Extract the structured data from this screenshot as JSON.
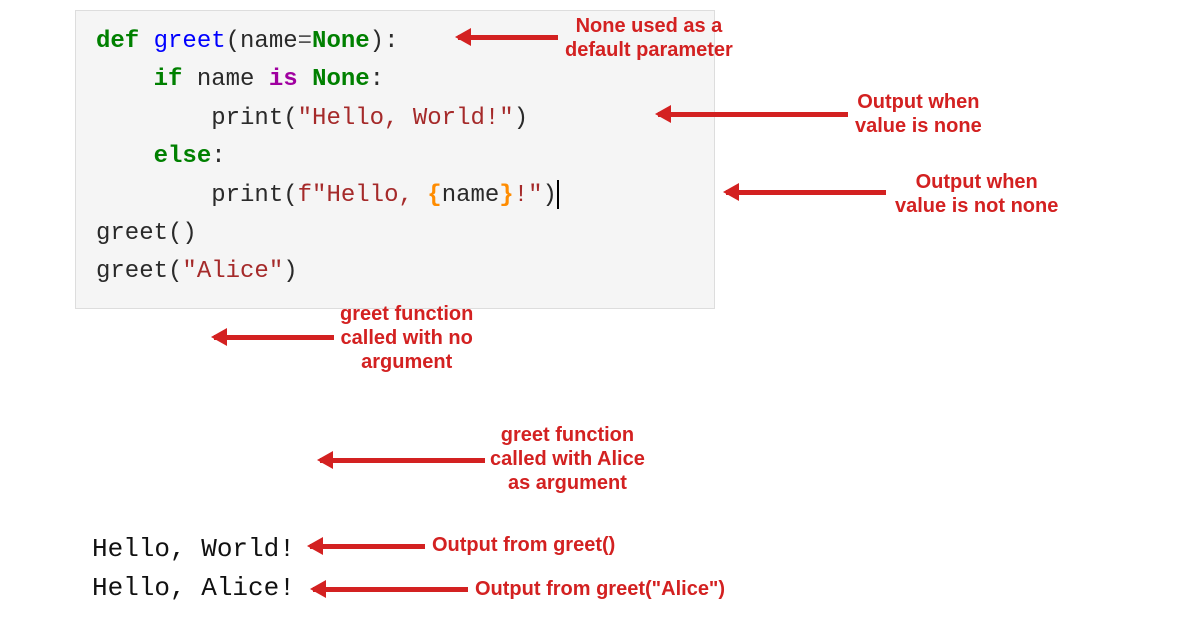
{
  "code": {
    "line1": {
      "def": "def ",
      "fname": "greet",
      "open": "(",
      "param": "name",
      "eq": "=",
      "none": "None",
      "close": ")",
      "colon": ":"
    },
    "line2": {
      "indent": "    ",
      "if": "if ",
      "name": "name",
      "sp": " ",
      "is": "is",
      "sp2": " ",
      "none": "None",
      "colon": ":"
    },
    "line3": {
      "indent": "        ",
      "print": "print",
      "open": "(",
      "str": "\"Hello, World!\"",
      "close": ")"
    },
    "line4": {
      "indent": "    ",
      "else": "else",
      "colon": ":"
    },
    "line5": {
      "indent": "        ",
      "print": "print",
      "open": "(",
      "f": "f",
      "q1": "\"",
      "s1": "Hello, ",
      "bo": "{",
      "interp": "name",
      "bc": "}",
      "s2": "!",
      "q2": "\"",
      "close": ")"
    },
    "line6": {
      "blank": ""
    },
    "line7": {
      "fn": "greet",
      "open": "(",
      "close": ")"
    },
    "line8": {
      "blank": ""
    },
    "line9": {
      "fn": "greet",
      "open": "(",
      "arg": "\"Alice\"",
      "close": ")"
    }
  },
  "output": {
    "line1": "Hello, World!",
    "line2": "Hello, Alice!"
  },
  "annotations": {
    "a1": "None used as a\ndefault parameter",
    "a2": "Output when\nvalue is none",
    "a3": "Output when\nvalue is not none",
    "a4": "greet function\ncalled with no\nargument",
    "a5": "greet function\ncalled with Alice\nas argument",
    "a6": "Output from greet()",
    "a7": "Output from greet(\"Alice\")"
  }
}
